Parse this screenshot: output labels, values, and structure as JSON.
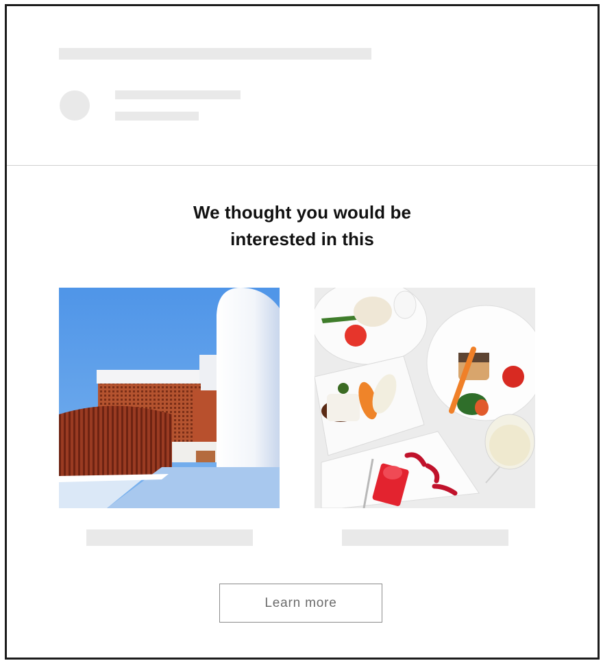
{
  "headline": {
    "line1": "We thought you would be",
    "line2": "interested in this"
  },
  "cards": [
    {
      "image_name": "architecture-photo"
    },
    {
      "image_name": "food-plates-photo"
    }
  ],
  "cta": {
    "label": "Learn more"
  },
  "colors": {
    "placeholder": "#e9e9e9",
    "border": "#1c1c1c",
    "sky": "#5b9be6"
  }
}
